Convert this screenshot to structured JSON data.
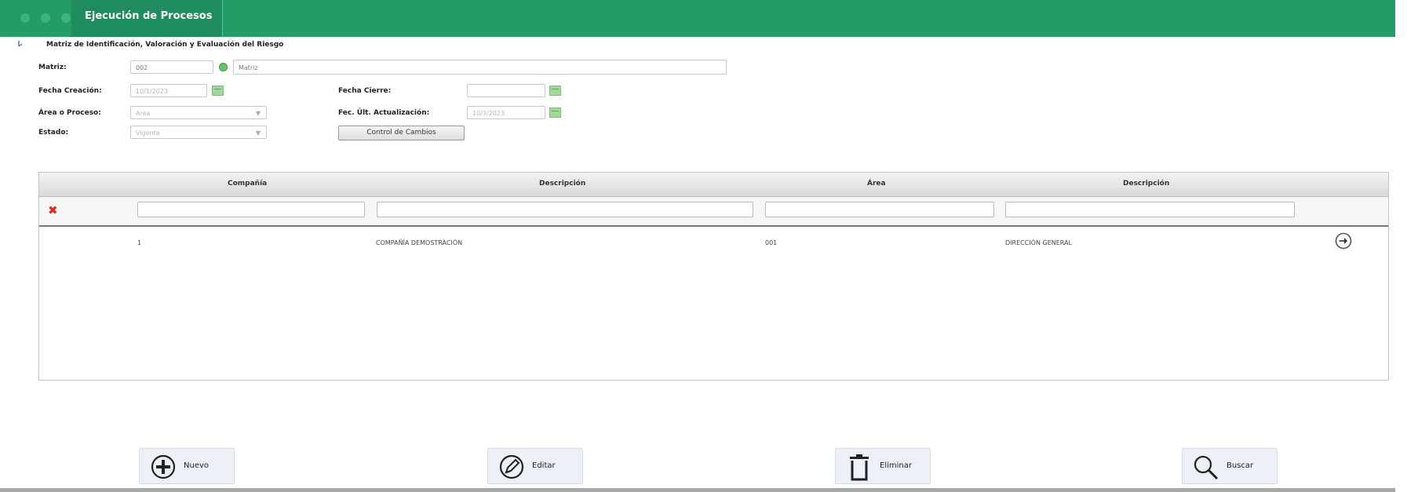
{
  "window": {
    "title": "Ejecución de Procesos"
  },
  "section": {
    "heading": "Matriz de Identificación, Valoración y Evaluación del Riesgo"
  },
  "form": {
    "matriz_label": "Matriz:",
    "matriz_code": "002",
    "matriz_name": "Matriz",
    "fecha_creacion_label": "Fecha Creación:",
    "fecha_creacion_value": "10/1/2023",
    "fecha_cierre_label": "Fecha Cierre:",
    "fecha_cierre_value": "",
    "area_label": "Área o Proceso:",
    "area_value": "Area",
    "fec_ult_label": "Fec. Últ. Actualización:",
    "fec_ult_value": "10/3/2023",
    "estado_label": "Estado:",
    "estado_value": "Vigente",
    "control_cambios_label": "Control de Cambios"
  },
  "grid": {
    "columns": [
      "Compañía",
      "Descripción",
      "Área",
      "Descripción"
    ],
    "rows": [
      {
        "compania": "1",
        "descripcion_compania": "COMPAÑÍA DEMOSTRACIÓN",
        "area": "001",
        "descripcion_area": "DIRECCIÓN GENERAL"
      }
    ]
  },
  "actions": {
    "nuevo": "Nuevo",
    "editar": "Editar",
    "eliminar": "Eliminar",
    "buscar": "Buscar"
  },
  "icons": {
    "clear_filter": "close-icon",
    "row_go": "arrow-right-circle-icon",
    "new": "plus-circle-icon",
    "edit": "pencil-circle-icon",
    "delete": "trash-icon",
    "search": "search-icon",
    "calendar": "calendar-icon"
  },
  "colors": {
    "header_green": "#239c68",
    "active_tab_green": "#1e8c5c",
    "clear_red": "#e0291a"
  }
}
